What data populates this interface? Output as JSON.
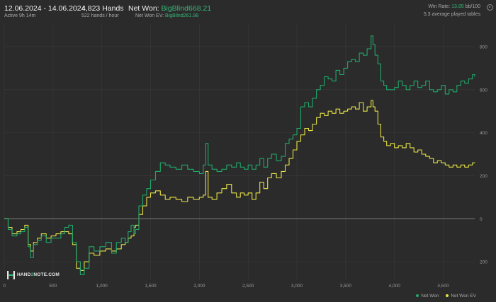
{
  "header": {
    "date_range": "12.06.2024 - 14.06.2024",
    "active": "Active 9h 14m",
    "hands": "4,823 Hands",
    "hands_per_hour": "522 hands / hour",
    "net_won_label": "Net Won: ",
    "net_won_value": "BigBlind668.21",
    "net_won_ev_label": "Net Won  EV: ",
    "net_won_ev_value": "BigBlind261.98",
    "win_rate_label": "Win Rate: ",
    "win_rate_value": "13.85",
    "win_rate_unit": " bb/100",
    "tables": "5.3 average played tables"
  },
  "logo": {
    "part1": "HAND",
    "part2": "2",
    "part3": "NOTE.COM"
  },
  "colors": {
    "net_won": "#21a86a",
    "net_won_ev": "#e6e245",
    "background": "#2b2b2b",
    "grid": "#3a3a3a",
    "zero_line": "#8a8a8a"
  },
  "icons": {
    "settings": "gear-icon"
  },
  "chart_data": {
    "type": "line",
    "xlim": [
      0,
      4823
    ],
    "ylim": [
      -285,
      905
    ],
    "x_ticks": [
      0,
      500,
      1000,
      1500,
      2000,
      2500,
      3000,
      3500,
      4000,
      4500
    ],
    "x_tick_labels": [
      "0",
      "500",
      "1,000",
      "1,500",
      "2,000",
      "2,500",
      "3,000",
      "3,500",
      "4,000",
      "4,500"
    ],
    "y_ticks": [
      800,
      600,
      400,
      200,
      0,
      -200
    ],
    "y_tick_labels": [
      "800",
      "600",
      "400",
      "200",
      "0",
      "200"
    ],
    "grid": true,
    "legend": "bottom-right",
    "series": [
      {
        "name": "Net Won",
        "x": [
          0,
          40,
          80,
          130,
          170,
          210,
          245,
          270,
          300,
          340,
          380,
          430,
          480,
          530,
          580,
          620,
          660,
          700,
          740,
          780,
          820,
          870,
          920,
          980,
          1040,
          1100,
          1150,
          1200,
          1240,
          1270,
          1300,
          1330,
          1345,
          1380,
          1420,
          1460,
          1500,
          1550,
          1600,
          1650,
          1700,
          1760,
          1820,
          1880,
          1940,
          2000,
          2040,
          2065,
          2090,
          2130,
          2180,
          2230,
          2280,
          2330,
          2380,
          2420,
          2460,
          2500,
          2540,
          2580,
          2620,
          2660,
          2700,
          2740,
          2790,
          2840,
          2880,
          2920,
          2960,
          3000,
          3040,
          3080,
          3120,
          3160,
          3200,
          3240,
          3280,
          3320,
          3360,
          3400,
          3440,
          3480,
          3520,
          3560,
          3600,
          3640,
          3680,
          3720,
          3760,
          3780,
          3800,
          3830,
          3860,
          3890,
          3920,
          3960,
          4000,
          4040,
          4080,
          4120,
          4160,
          4200,
          4240,
          4280,
          4320,
          4360,
          4400,
          4440,
          4480,
          4520,
          4560,
          4600,
          4640,
          4680,
          4720,
          4760,
          4800,
          4823
        ],
        "values": [
          0,
          -50,
          -80,
          -70,
          -60,
          -40,
          -130,
          -180,
          -120,
          -100,
          -80,
          -110,
          -90,
          -90,
          -70,
          -40,
          -30,
          -110,
          -200,
          -260,
          -230,
          -130,
          -150,
          -130,
          -110,
          -160,
          -110,
          -90,
          -110,
          -60,
          -30,
          -70,
          -50,
          60,
          110,
          140,
          180,
          220,
          260,
          250,
          240,
          230,
          250,
          230,
          220,
          210,
          250,
          350,
          250,
          230,
          220,
          230,
          250,
          240,
          260,
          240,
          230,
          250,
          230,
          250,
          280,
          240,
          280,
          300,
          270,
          290,
          350,
          370,
          390,
          420,
          520,
          540,
          520,
          560,
          600,
          620,
          660,
          650,
          640,
          690,
          670,
          700,
          730,
          740,
          730,
          770,
          760,
          790,
          850,
          810,
          760,
          720,
          640,
          620,
          600,
          600,
          610,
          640,
          620,
          600,
          620,
          640,
          610,
          620,
          640,
          600,
          590,
          600,
          620,
          580,
          600,
          590,
          620,
          640,
          630,
          650,
          670,
          660
        ]
      },
      {
        "name": "Net Won  EV",
        "x": [
          0,
          40,
          80,
          130,
          170,
          210,
          245,
          270,
          300,
          340,
          380,
          430,
          480,
          530,
          580,
          620,
          660,
          700,
          740,
          780,
          820,
          870,
          920,
          980,
          1040,
          1100,
          1150,
          1200,
          1240,
          1270,
          1300,
          1330,
          1345,
          1380,
          1420,
          1460,
          1500,
          1550,
          1600,
          1650,
          1700,
          1760,
          1820,
          1880,
          1940,
          2000,
          2040,
          2065,
          2090,
          2130,
          2180,
          2230,
          2280,
          2330,
          2380,
          2420,
          2460,
          2500,
          2540,
          2580,
          2620,
          2660,
          2700,
          2740,
          2790,
          2840,
          2880,
          2920,
          2960,
          3000,
          3040,
          3080,
          3120,
          3160,
          3200,
          3240,
          3280,
          3320,
          3360,
          3400,
          3440,
          3480,
          3520,
          3560,
          3600,
          3640,
          3680,
          3720,
          3760,
          3780,
          3800,
          3830,
          3860,
          3890,
          3920,
          3960,
          4000,
          4040,
          4080,
          4120,
          4160,
          4200,
          4240,
          4280,
          4320,
          4360,
          4400,
          4440,
          4480,
          4520,
          4560,
          4600,
          4640,
          4680,
          4720,
          4760,
          4800,
          4823
        ],
        "values": [
          0,
          -40,
          -70,
          -60,
          -50,
          -30,
          -120,
          -150,
          -110,
          -90,
          -70,
          -90,
          -80,
          -70,
          -60,
          -60,
          -70,
          -120,
          -230,
          -240,
          -200,
          -160,
          -170,
          -150,
          -140,
          -150,
          -140,
          -120,
          -110,
          -90,
          -80,
          -40,
          -30,
          20,
          60,
          100,
          120,
          130,
          110,
          90,
          100,
          90,
          80,
          100,
          90,
          100,
          110,
          220,
          100,
          90,
          120,
          140,
          160,
          120,
          100,
          120,
          110,
          120,
          90,
          120,
          170,
          140,
          190,
          210,
          190,
          220,
          250,
          280,
          320,
          360,
          390,
          420,
          410,
          440,
          470,
          490,
          480,
          500,
          490,
          510,
          490,
          500,
          510,
          520,
          510,
          540,
          500,
          520,
          550,
          520,
          500,
          440,
          380,
          360,
          340,
          350,
          330,
          340,
          330,
          350,
          330,
          310,
          320,
          300,
          290,
          280,
          260,
          270,
          260,
          250,
          240,
          250,
          240,
          250,
          240,
          250,
          260,
          262
        ]
      }
    ]
  }
}
